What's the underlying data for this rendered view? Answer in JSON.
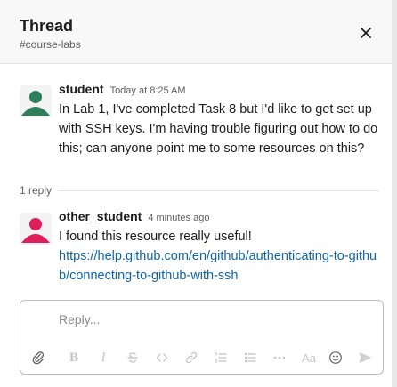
{
  "header": {
    "title": "Thread",
    "channel": "#course-labs",
    "close_icon": "close-icon"
  },
  "messages": [
    {
      "username": "student",
      "timestamp": "Today at 8:25 AM",
      "avatar_color": "#2e8b57",
      "text": "In Lab 1, I've completed Task 8 but I'd like to get set up with SSH keys. I'm having trouble figuring out how to do this; can anyone point me to some resources on this?"
    },
    {
      "username": "other_student",
      "timestamp": "4 minutes ago",
      "avatar_color": "#e01e5a",
      "text": "I found this resource really useful!",
      "link": "https://help.github.com/en/github/authenticating-to-github/connecting-to-github-with-ssh"
    }
  ],
  "reply_divider": {
    "label": "1 reply"
  },
  "composer": {
    "placeholder": "Reply...",
    "tools": {
      "bold": "B",
      "italic": "I",
      "aa": "Aa"
    }
  },
  "colors": {
    "link": "#1264a3",
    "text": "#1d1c1d",
    "muted": "#616061"
  }
}
